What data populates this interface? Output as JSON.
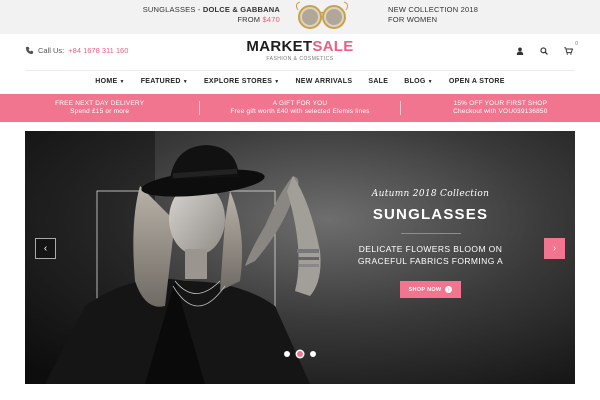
{
  "promo": {
    "left_line1_prefix": "SUNGLASSES - ",
    "left_line1_bold": "DOLCE & GABBANA",
    "left_line2_prefix": "FROM ",
    "left_price": "$470",
    "right_line1": "NEW COLLECTION 2018",
    "right_line2": "FOR WOMEN"
  },
  "header": {
    "call_label": "Call Us:",
    "call_number": "+84 1678 311 160",
    "brand_main": "MARKET",
    "brand_accent": "SALE",
    "tagline": "FASHION & COSMETICS",
    "cart_count": "0",
    "icons": [
      "user-icon",
      "search-icon",
      "cart-icon"
    ]
  },
  "nav": {
    "items": [
      {
        "label": "HOME",
        "dropdown": true
      },
      {
        "label": "FEATURED",
        "dropdown": true
      },
      {
        "label": "EXPLORE STORES",
        "dropdown": true
      },
      {
        "label": "NEW ARRIVALS",
        "dropdown": false
      },
      {
        "label": "SALE",
        "dropdown": false
      },
      {
        "label": "BLOG",
        "dropdown": true
      },
      {
        "label": "OPEN A STORE",
        "dropdown": false
      }
    ]
  },
  "band": {
    "cells": [
      {
        "line1": "FREE NEXT DAY DELIVERY",
        "line2": "Spend £15 or more"
      },
      {
        "line1": "A GIFT FOR YOU",
        "line2": "Free gift worth £40 with selected Elemis lines"
      },
      {
        "line1": "15% OFF YOUR FIRST SHOP",
        "line2": "Checkout with VOU039136850"
      }
    ]
  },
  "hero": {
    "script": "Autumn 2018 Collection",
    "title": "SUNGLASSES",
    "sub_line1": "DELICATE FLOWERS BLOOM ON",
    "sub_line2": "GRACEFUL FABRICS FORMING A",
    "button_label": "SHOP NOW",
    "slide_count": 3,
    "active_slide": 2
  },
  "colors": {
    "accent": "#f2758f",
    "accent_text": "#ef5e7f",
    "promo_bg": "#f2f2f2"
  }
}
